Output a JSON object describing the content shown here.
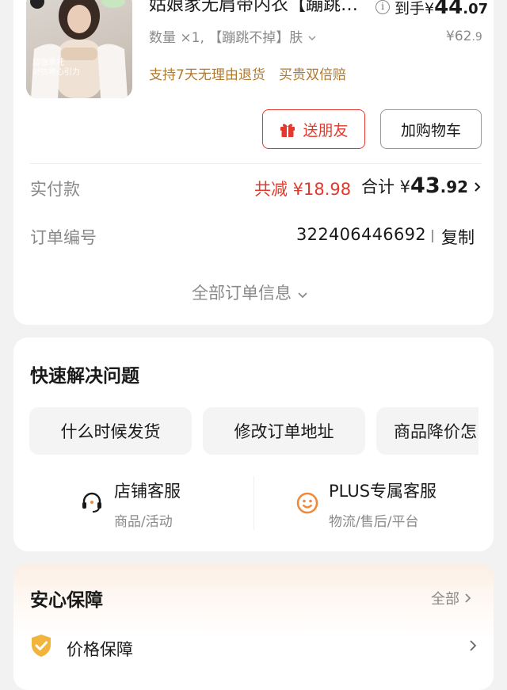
{
  "product": {
    "title": "姑娘家无肩带内衣【蹦跳不掉】肤",
    "final_price_prefix": "到手¥",
    "final_price_int": "44",
    "final_price_dec": ".07",
    "quantity_text": "数量 ×1, 【蹦跳不掉】肤",
    "original_price_int": "¥62",
    "original_price_dec": ".9",
    "promo_return": "支持7天无理由退货",
    "promo_double": "买贵双倍赔",
    "image_text_line1": "超强承托",
    "image_text_line2": "对抗地心引力"
  },
  "actions": {
    "gift_label": "送朋友",
    "cart_label": "加购物车"
  },
  "payment": {
    "label": "实付款",
    "reduce_text": "共减 ¥18.98",
    "total_prefix": "合计 ¥",
    "total_int": "43",
    "total_dec": ".92"
  },
  "order": {
    "label": "订单编号",
    "number": "322406446692",
    "copy_label": "复制",
    "all_info_label": "全部订单信息"
  },
  "quick": {
    "title": "快速解决问题",
    "chips": [
      "什么时候发货",
      "修改订单地址",
      "商品降价怎"
    ],
    "service": [
      {
        "title": "店铺客服",
        "sub": "商品/活动",
        "icon": "headset-icon"
      },
      {
        "title": "PLUS专属客服",
        "sub": "物流/售后/平台",
        "icon": "smiley-service-icon"
      }
    ]
  },
  "guarantee": {
    "title": "安心保障",
    "all_label": "全部",
    "item_label": "价格保障"
  },
  "colors": {
    "accent_red": "#e1392c",
    "promo_gold": "#b07a30",
    "service_orange": "#f08a3a",
    "shield_gold": "#f1b43c"
  }
}
